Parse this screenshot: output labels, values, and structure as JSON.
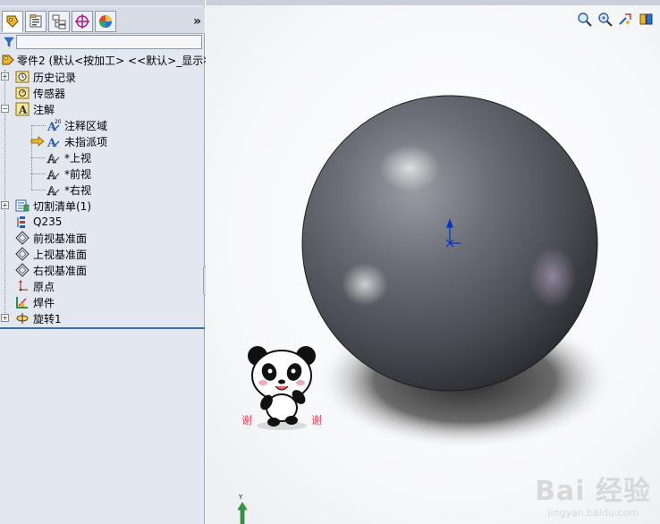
{
  "panel": {
    "more_label": "»",
    "tabs": [
      "feature-manager",
      "property-manager",
      "configuration-manager",
      "dimxpert-manager",
      "display-manager"
    ]
  },
  "tree": {
    "root": "零件2 (默认<按加工> <<默认>_显示状",
    "items": [
      {
        "label": "历史记录",
        "icon": "history-icon"
      },
      {
        "label": "传感器",
        "icon": "sensor-icon"
      },
      {
        "label": "注解",
        "icon": "annotation-icon"
      },
      {
        "label": "注释区域",
        "icon": "notes-area-icon"
      },
      {
        "label": "未指派项",
        "icon": "unassigned-icon"
      },
      {
        "label": "*上视",
        "icon": "view-icon"
      },
      {
        "label": "*前视",
        "icon": "view-icon"
      },
      {
        "label": "*右视",
        "icon": "view-icon"
      },
      {
        "label": "切割清单(1)",
        "icon": "cut-list-icon"
      },
      {
        "label": "Q235",
        "icon": "material-icon"
      },
      {
        "label": "前视基准面",
        "icon": "plane-icon"
      },
      {
        "label": "上视基准面",
        "icon": "plane-icon"
      },
      {
        "label": "右视基准面",
        "icon": "plane-icon"
      },
      {
        "label": "原点",
        "icon": "origin-icon"
      },
      {
        "label": "焊件",
        "icon": "weldment-icon"
      },
      {
        "label": "旋转1",
        "icon": "revolve-icon"
      }
    ]
  },
  "viewport": {
    "hud_icons": [
      "zoom-fit-icon",
      "zoom-area-icon",
      "previous-view-icon",
      "section-view-icon"
    ],
    "watermark": "Bai 经验",
    "watermark_sub": "jingyan.baidu.com",
    "panda_text_left": "谢",
    "panda_text_right": "谢",
    "triad_label": "Y"
  },
  "colors": {
    "panel_bg": "#e3e7ef",
    "sphere": "#5b5e66",
    "accent_blue": "#3a6ea5",
    "origin_blue": "#0033cc"
  }
}
